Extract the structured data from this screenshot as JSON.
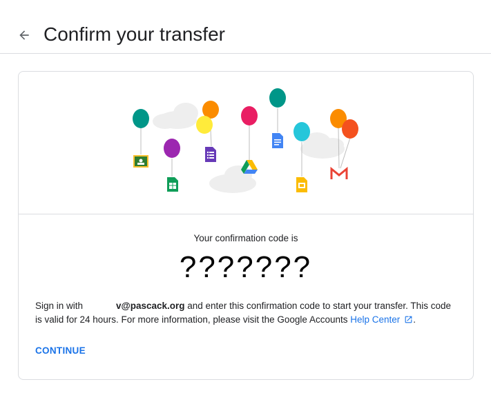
{
  "header": {
    "back_icon": "arrow-back-icon",
    "title": "Confirm your transfer"
  },
  "illustration": {
    "description_icons": [
      "classroom-icon",
      "sheets-icon",
      "forms-icon",
      "drive-icon",
      "docs-icon",
      "slides-icon",
      "gmail-icon"
    ],
    "balloon_colors": [
      "#009688",
      "#9c27b0",
      "#fb8c00",
      "#ffeb3b",
      "#e91e63",
      "#009688",
      "#26c6da",
      "#fb8c00",
      "#f4511e"
    ]
  },
  "confirmation": {
    "label": "Your confirmation code is",
    "code": "???????"
  },
  "message": {
    "prefix": "Sign in with",
    "email": "v@pascack.org",
    "middle": " and enter this confirmation code to start your transfer. This code is valid for 24 hours. For more information, please visit the Google Accounts ",
    "link_text": "Help Center",
    "suffix": ".",
    "external_icon": "open-in-new-icon"
  },
  "actions": {
    "continue_label": "CONTINUE"
  },
  "colors": {
    "accent": "#1a73e8",
    "border": "#dadce0",
    "text": "#202124"
  }
}
